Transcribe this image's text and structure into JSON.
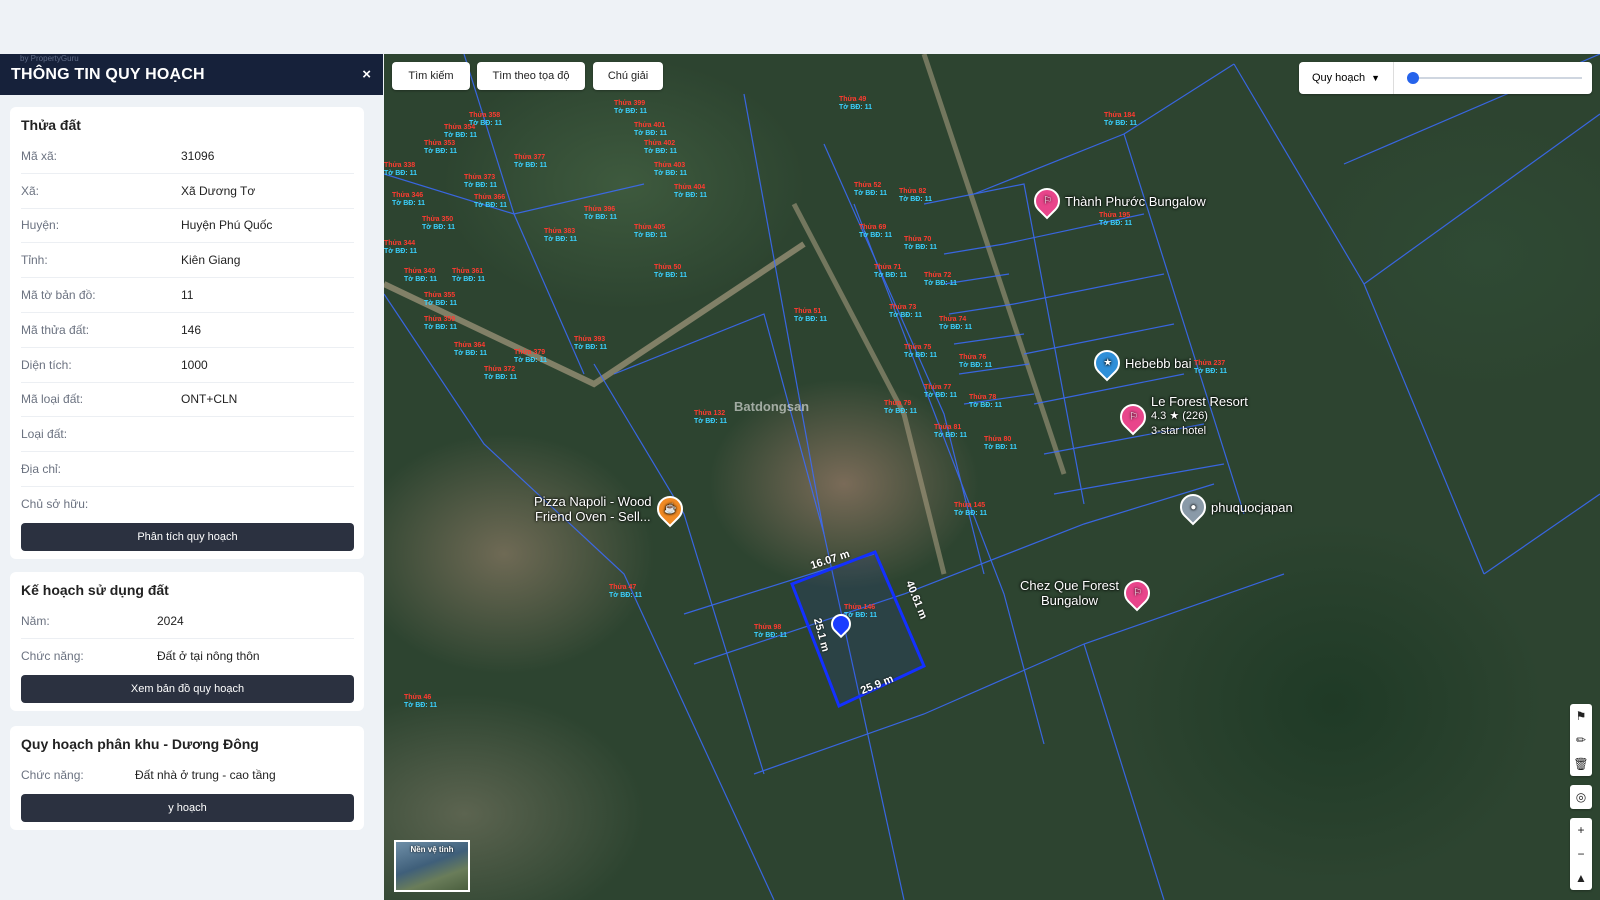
{
  "brand_text": "by PropertyGuru",
  "sidebar": {
    "title": "THÔNG TIN QUY HOẠCH",
    "close_label": "×",
    "parcel": {
      "heading": "Thửa đất",
      "rows": [
        {
          "label": "Mã xã:",
          "value": "31096"
        },
        {
          "label": "Xã:",
          "value": "Xã Dương Tơ"
        },
        {
          "label": "Huyện:",
          "value": "Huyện Phú Quốc"
        },
        {
          "label": "Tỉnh:",
          "value": "Kiên Giang"
        },
        {
          "label": "Mã tờ bản đồ:",
          "value": "11"
        },
        {
          "label": "Mã thửa đất:",
          "value": "146"
        },
        {
          "label": "Diện tích:",
          "value": "1000"
        },
        {
          "label": "Mã loại đất:",
          "value": "ONT+CLN"
        },
        {
          "label": "Loại đất:",
          "value": ""
        },
        {
          "label": "Địa chỉ:",
          "value": ""
        },
        {
          "label": "Chủ sở hữu:",
          "value": ""
        }
      ],
      "button": "Phân tích quy hoạch"
    },
    "land_use": {
      "heading": "Kế hoạch sử dụng đất",
      "rows": [
        {
          "label": "Năm:",
          "value": "2024"
        },
        {
          "label": "Chức năng:",
          "value": "Đất ở tại nông thôn"
        }
      ],
      "button": "Xem bản đồ quy hoạch"
    },
    "zoning": {
      "heading": "Quy hoạch phân khu - Dương Đông",
      "rows": [
        {
          "label": "Chức năng:",
          "value": "Đất nhà ở trung - cao tầng"
        }
      ],
      "button": "y hoạch"
    }
  },
  "map": {
    "buttons": {
      "search": "Tìm kiếm",
      "coords": "Tìm theo tọa độ",
      "legend": "Chú giải"
    },
    "layer_select": "Quy hoạch",
    "opacity_slider": 0.03,
    "minimap_label": "Nền vệ tinh",
    "watermark": "Batdongsan",
    "pois": [
      {
        "name": "Thành Phước Bungalow",
        "icon": "hotel-icon",
        "color": "#e8458b"
      },
      {
        "name": "Hebebb bai",
        "icon": "shop-icon",
        "color": "#2f8fd8"
      },
      {
        "name": "Le Forest Resort",
        "sub1": "4.3 ★ (226)",
        "sub2": "3-star hotel",
        "icon": "hotel-icon",
        "color": "#e8458b"
      },
      {
        "name": "phuquocjapan",
        "icon": "place-icon",
        "color": "#8a9aa8"
      },
      {
        "name": "Pizza Napoli - Wood\nFriend Oven - Sell...",
        "icon": "restaurant-icon",
        "color": "#f08a24"
      },
      {
        "name": "Chez Que Forest\nBungalow",
        "icon": "hotel-icon",
        "color": "#e8458b"
      }
    ],
    "dimensions": [
      "16.07 m",
      "40.61 m",
      "25.1 m",
      "25.9 m"
    ],
    "lots": [
      {
        "t": "Thửa 358",
        "b": "Tờ BĐ: 11"
      },
      {
        "t": "Thửa 354",
        "b": "Tờ BĐ: 11"
      },
      {
        "t": "Thửa 353",
        "b": "Tờ BĐ: 11"
      },
      {
        "t": "Thửa 338",
        "b": "Tờ BĐ: 11"
      },
      {
        "t": "Thửa 346",
        "b": "Tờ BĐ: 11"
      },
      {
        "t": "Thửa 350",
        "b": "Tờ BĐ: 11"
      },
      {
        "t": "Thửa 344",
        "b": "Tờ BĐ: 11"
      },
      {
        "t": "Thửa 340",
        "b": "Tờ BĐ: 11"
      },
      {
        "t": "Thửa 355",
        "b": "Tờ BĐ: 11"
      },
      {
        "t": "Thửa 359",
        "b": "Tờ BĐ: 11"
      },
      {
        "t": "Thửa 364",
        "b": "Tờ BĐ: 11"
      },
      {
        "t": "Thửa 372",
        "b": "Tờ BĐ: 11"
      },
      {
        "t": "Thửa 361",
        "b": "Tờ BĐ: 11"
      },
      {
        "t": "Thửa 366",
        "b": "Tờ BĐ: 11"
      },
      {
        "t": "Thửa 373",
        "b": "Tờ BĐ: 11"
      },
      {
        "t": "Thửa 377",
        "b": "Tờ BĐ: 11"
      },
      {
        "t": "Thửa 383",
        "b": "Tờ BĐ: 11"
      },
      {
        "t": "Thửa 396",
        "b": "Tờ BĐ: 11"
      },
      {
        "t": "Thửa 399",
        "b": "Tờ BĐ: 11"
      },
      {
        "t": "Thửa 401",
        "b": "Tờ BĐ: 11"
      },
      {
        "t": "Thửa 402",
        "b": "Tờ BĐ: 11"
      },
      {
        "t": "Thửa 403",
        "b": "Tờ BĐ: 11"
      },
      {
        "t": "Thửa 404",
        "b": "Tờ BĐ: 11"
      },
      {
        "t": "Thửa 405",
        "b": "Tờ BĐ: 11"
      },
      {
        "t": "Thửa 50",
        "b": "Tờ BĐ: 11"
      },
      {
        "t": "Thửa 393",
        "b": "Tờ BĐ: 11"
      },
      {
        "t": "Thửa 379",
        "b": "Tờ BĐ: 11"
      },
      {
        "t": "Thửa 49",
        "b": "Tờ BĐ: 11"
      },
      {
        "t": "Thửa 52",
        "b": "Tờ BĐ: 11"
      },
      {
        "t": "Thửa 69",
        "b": "Tờ BĐ: 11"
      },
      {
        "t": "Thửa 70",
        "b": "Tờ BĐ: 11"
      },
      {
        "t": "Thửa 71",
        "b": "Tờ BĐ: 11"
      },
      {
        "t": "Thửa 72",
        "b": "Tờ BĐ: 11"
      },
      {
        "t": "Thửa 73",
        "b": "Tờ BĐ: 11"
      },
      {
        "t": "Thửa 74",
        "b": "Tờ BĐ: 11"
      },
      {
        "t": "Thửa 75",
        "b": "Tờ BĐ: 11"
      },
      {
        "t": "Thửa 76",
        "b": "Tờ BĐ: 11"
      },
      {
        "t": "Thửa 77",
        "b": "Tờ BĐ: 11"
      },
      {
        "t": "Thửa 78",
        "b": "Tờ BĐ: 11"
      },
      {
        "t": "Thửa 79",
        "b": "Tờ BĐ: 11"
      },
      {
        "t": "Thửa 80",
        "b": "Tờ BĐ: 11"
      },
      {
        "t": "Thửa 81",
        "b": "Tờ BĐ: 11"
      },
      {
        "t": "Thửa 51",
        "b": "Tờ BĐ: 11"
      },
      {
        "t": "Thửa 132",
        "b": "Tờ BĐ: 11"
      },
      {
        "t": "Thửa 145",
        "b": "Tờ BĐ: 11"
      },
      {
        "t": "Thửa 146",
        "b": "Tờ BĐ: 11"
      },
      {
        "t": "Thửa 98",
        "b": "Tờ BĐ: 11"
      },
      {
        "t": "Thửa 47",
        "b": "Tờ BĐ: 11"
      },
      {
        "t": "Thửa 46",
        "b": "Tờ BĐ: 11"
      },
      {
        "t": "Thửa 195",
        "b": "Tờ BĐ: 11"
      },
      {
        "t": "Thửa 184",
        "b": "Tờ BĐ: 11"
      },
      {
        "t": "Thửa 237",
        "b": "Tờ BĐ: 11"
      },
      {
        "t": "Thửa 82",
        "b": "Tờ BĐ: 11"
      }
    ]
  }
}
